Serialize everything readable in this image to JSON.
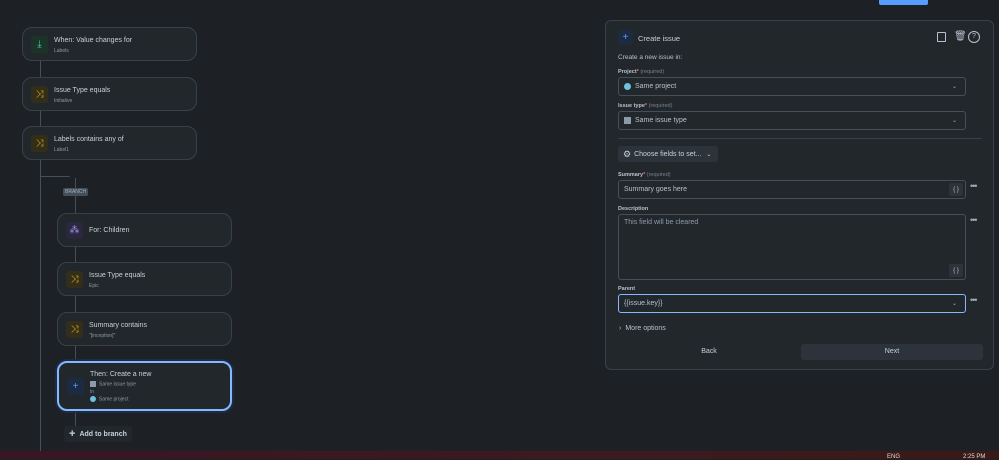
{
  "flow": {
    "nodes": [
      {
        "title": "When: Value changes for",
        "subtitle": "Labels",
        "icon": "download-arrow-icon"
      },
      {
        "title": "Issue Type equals",
        "subtitle": "Initiative",
        "icon": "shuffle-icon"
      },
      {
        "title": "Labels contains any of",
        "subtitle": "Label1",
        "icon": "shuffle-icon"
      }
    ],
    "branch_label": "BRANCH",
    "branch_nodes": [
      {
        "title": "For: Children",
        "icon": "hierarchy-icon"
      },
      {
        "title": "Issue Type equals",
        "subtitle": "Epic",
        "icon": "shuffle-icon"
      },
      {
        "title": "Summary contains",
        "subtitle": "\"[inception]\"",
        "icon": "shuffle-icon"
      }
    ],
    "action": {
      "title": "Then: Create a new",
      "issue_type": "Same issue type",
      "in": "in",
      "project": "Same project"
    },
    "add_to_branch": "Add to branch"
  },
  "panel": {
    "title": "Create issue",
    "intro": "Create a new issue in:",
    "required": "(required)",
    "project_label": "Project",
    "project_value": "Same project",
    "issue_type_label": "Issue type",
    "issue_type_value": "Same issue type",
    "choose_fields": "Choose fields to set...",
    "summary_label": "Summary",
    "summary_value": "Summary goes here",
    "description_label": "Description",
    "description_placeholder": "This field will be cleared",
    "parent_label": "Parent",
    "parent_value": "{{issue.key}}",
    "more_options": "More options",
    "back": "Back",
    "next": "Next",
    "brace": "{ }"
  },
  "taskbar": {
    "lang": "ENG",
    "time": "2:25 PM"
  }
}
